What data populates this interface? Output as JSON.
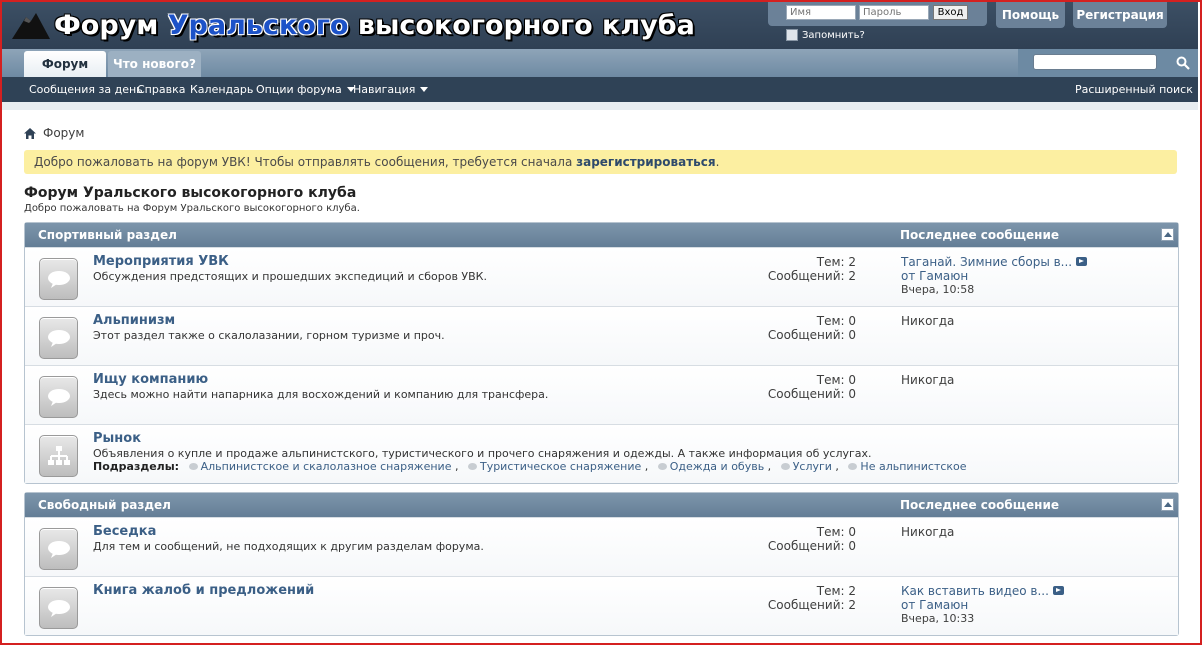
{
  "header": {
    "logo_part1": "Форум ",
    "logo_part2": "Уральского",
    "logo_part3": " высокогорного клуба",
    "username_placeholder": "Имя",
    "password_placeholder": "Пароль",
    "login_button": "Вход",
    "remember_label": "Запомнить?",
    "help_button": "Помощь",
    "register_button": "Регистрация"
  },
  "navbar": {
    "tabs": [
      "Форум",
      "Что нового?"
    ],
    "links": [
      "Сообщения за день",
      "Справка",
      "Календарь",
      "Опции форума",
      "Навигация"
    ],
    "advanced_search": "Расширенный поиск"
  },
  "breadcrumb": "Форум",
  "notice": {
    "text": "Добро пожаловать на форум УВК! Чтобы отправлять сообщения, требуется сначала ",
    "link": "зарегистрироваться",
    "end": "."
  },
  "page": {
    "title": "Форум Уральского высокогорного клуба",
    "desc": "Добро пожаловать на Форум Уральского высокогорного клуба."
  },
  "categories": [
    {
      "name": "Спортивный раздел",
      "last_header": "Последнее сообщение",
      "forums": [
        {
          "title": "Мероприятия УВК",
          "desc": "Обсуждения предстоящих и прошедших экспедиций и сборов УВК.",
          "topics": "Тем: 2",
          "posts": "Сообщений: 2",
          "last_title": "Таганай. Зимние сборы в...",
          "last_by": "от Гамаюн",
          "last_time": "Вчера, 10:58"
        },
        {
          "title": "Альпинизм",
          "desc": "Этот раздел также о скалолазании, горном туризме и проч.",
          "topics": "Тем: 0",
          "posts": "Сообщений: 0",
          "last_never": "Никогда"
        },
        {
          "title": "Ищу компанию",
          "desc": "Здесь можно найти напарника для восхождений и компанию для трансфера.",
          "topics": "Тем: 0",
          "posts": "Сообщений: 0",
          "last_never": "Никогда"
        },
        {
          "title": "Рынок",
          "desc": "Объявления о купле и продаже альпинистского, туристического и прочего снаряжения и одежды. А также информация об услугах.",
          "subforums_label": "Подразделы:",
          "subforums": [
            "Альпинистское и скалолазное снаряжение",
            "Туристическое снаряжение",
            "Одежда и обувь",
            "Услуги",
            "Не альпинистское"
          ]
        }
      ]
    },
    {
      "name": "Свободный раздел",
      "last_header": "Последнее сообщение",
      "forums": [
        {
          "title": "Беседка",
          "desc": "Для тем и сообщений, не подходящих к другим разделам форума.",
          "topics": "Тем: 0",
          "posts": "Сообщений: 0",
          "last_never": "Никогда"
        },
        {
          "title": "Книга жалоб и предложений",
          "desc": "",
          "topics": "Тем: 2",
          "posts": "Сообщений: 2",
          "last_title": "Как вставить видео в...",
          "last_by": "от Гамаюн",
          "last_time": "Вчера, 10:33"
        }
      ]
    }
  ]
}
